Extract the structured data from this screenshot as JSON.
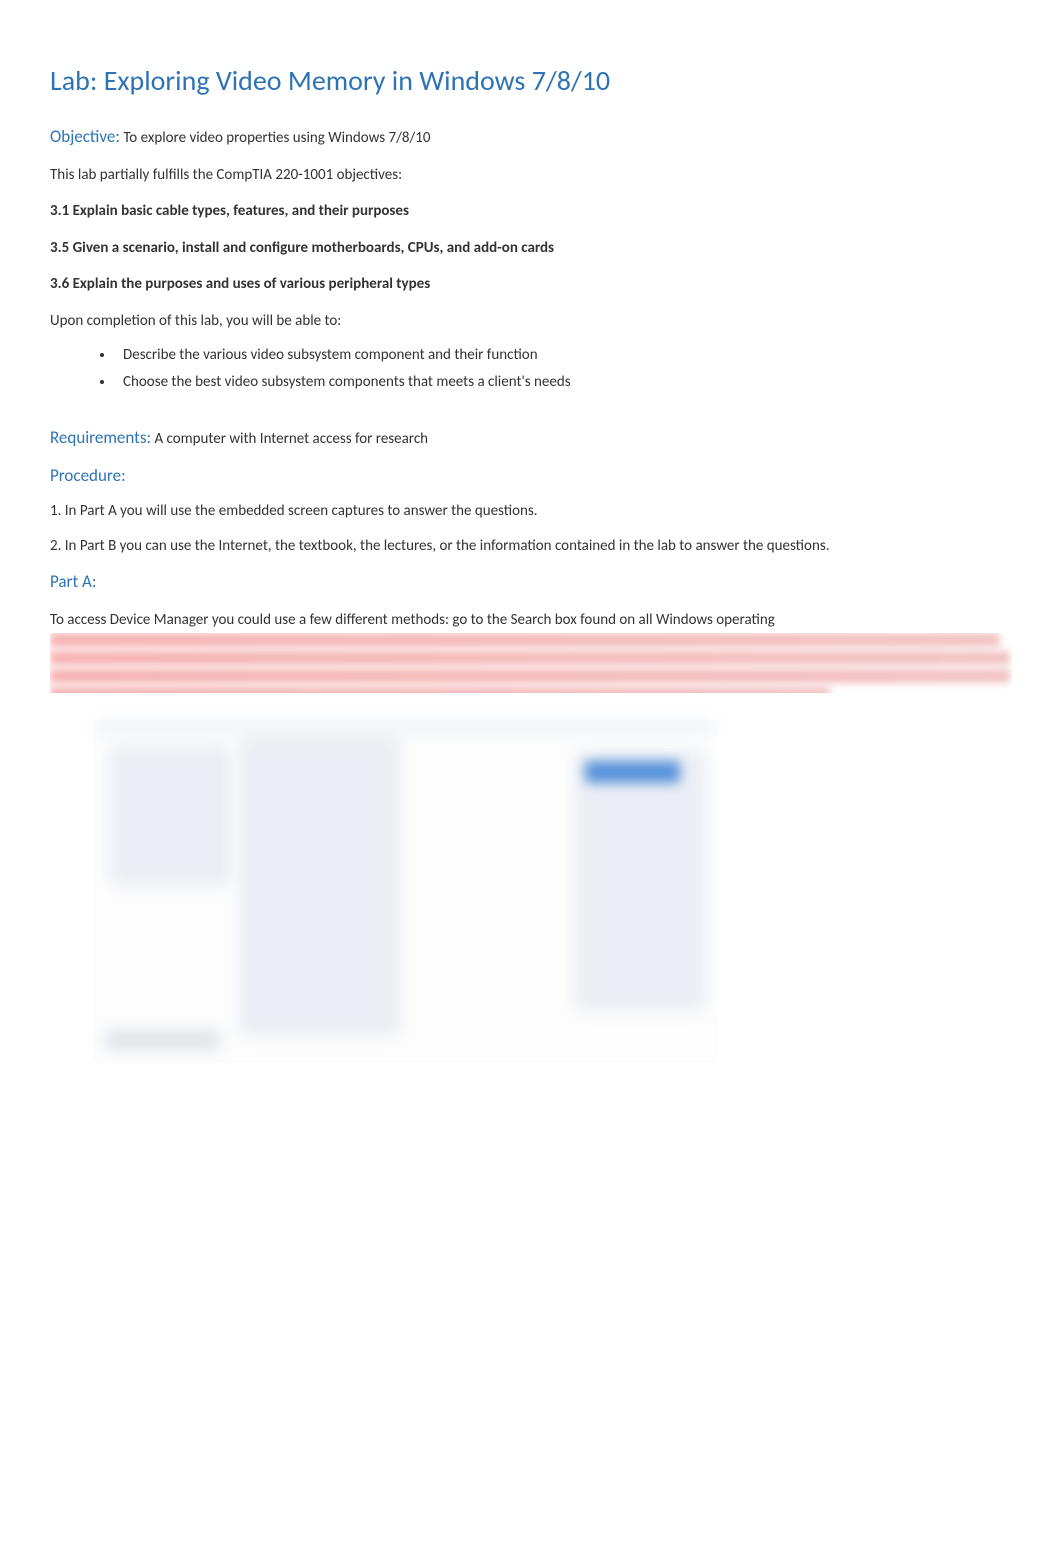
{
  "title": "Lab: Exploring Video Memory in Windows 7/8/10",
  "objective": {
    "heading": "Objective:",
    "text": " To explore video properties using Windows 7/8/10"
  },
  "intro": "This lab partially fulfills the CompTIA 220-1001 objectives:",
  "objectives": [
    "3.1 Explain basic cable types, features, and their purposes",
    "3.5 Given a scenario, install and configure motherboards, CPUs, and add-on cards",
    "3.6 Explain the purposes and uses of various peripheral types"
  ],
  "completion_intro": "Upon completion of this lab, you will be able to:",
  "bullets": [
    "Describe the various video subsystem component and their function",
    "Choose the best video subsystem components that meets a client's needs"
  ],
  "requirements": {
    "heading": "Requirements:",
    "text": " A computer with Internet access for research"
  },
  "procedure": {
    "heading": "Procedure:",
    "steps": [
      "1. In Part A you will use the embedded screen captures to answer the questions.",
      "2. In Part B you can use the Internet, the textbook, the lectures, or the information contained in the lab to answer the questions."
    ]
  },
  "partA": {
    "heading": "Part A:",
    "text": "To access Device Manager you could use a few different methods: go to the Search box found on all Windows operating"
  }
}
